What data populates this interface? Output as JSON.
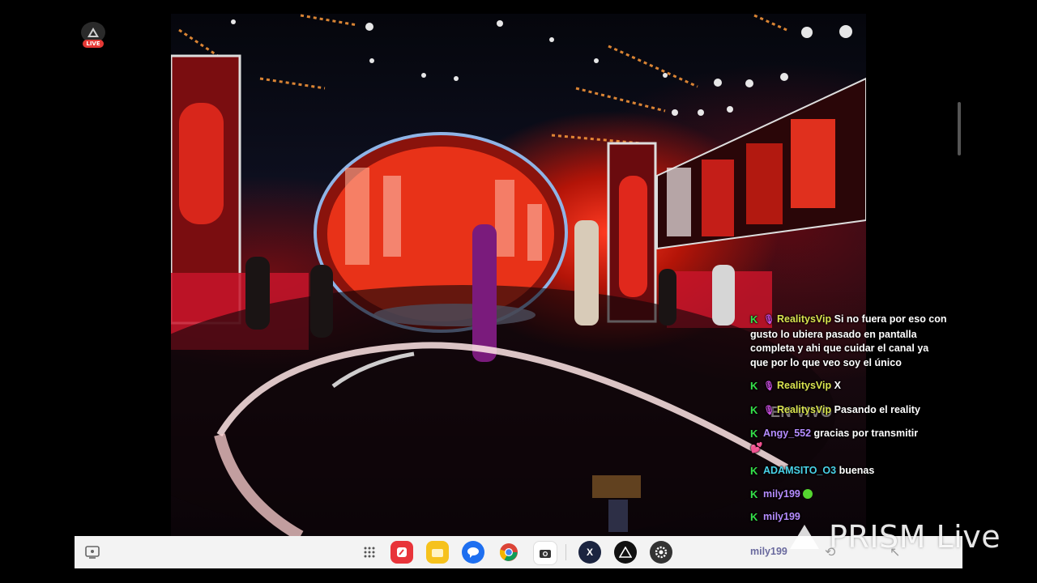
{
  "live_indicator": {
    "badge": "LIVE"
  },
  "video": {
    "overlay_text": "EN VIVO"
  },
  "chat": {
    "messages": [
      {
        "user": "RealitysVip",
        "text": "Si  no fuera por eso con gusto lo ubiera pasado en pantalla completa y ahi que cuidar el canal ya que por lo que veo soy el único",
        "color": "#d9e34f",
        "has_mic": true
      },
      {
        "user": "RealitysVip",
        "text": "X",
        "color": "#d9e34f",
        "has_mic": true
      },
      {
        "user": "RealitysVip",
        "text": "Pasando el reality",
        "color": "#d9e34f",
        "has_mic": true
      },
      {
        "user": "Angy_552",
        "text": "gracias por transmitir",
        "suffix": "💕",
        "color": "#b58cff"
      },
      {
        "user": "ADAMSITO_O3",
        "text": "buenas",
        "color": "#49d2e8"
      },
      {
        "user": "mily199",
        "text": "",
        "color": "#b58cff",
        "emoji": "smile"
      },
      {
        "user": "mily199",
        "text": "",
        "color": "#b58cff"
      },
      {
        "user": "mily199",
        "text": "",
        "color": "#b58cff"
      }
    ]
  },
  "taskbar": {
    "apps": [
      {
        "name": "app-drawer-icon"
      },
      {
        "name": "notes-app-icon",
        "color": "#e8343a"
      },
      {
        "name": "my-files-icon",
        "color": "#f6c21c"
      },
      {
        "name": "messages-icon",
        "color": "#1e6ff0"
      },
      {
        "name": "chrome-icon"
      },
      {
        "name": "camera-icon",
        "color": "#3a3a3a"
      },
      {
        "name": "xtream-app-icon",
        "color": "#1b2440"
      },
      {
        "name": "prism-app-icon",
        "color": "#111111"
      },
      {
        "name": "settings-icon",
        "color": "#333333"
      }
    ]
  },
  "watermark": {
    "text": "PRISM Live"
  }
}
